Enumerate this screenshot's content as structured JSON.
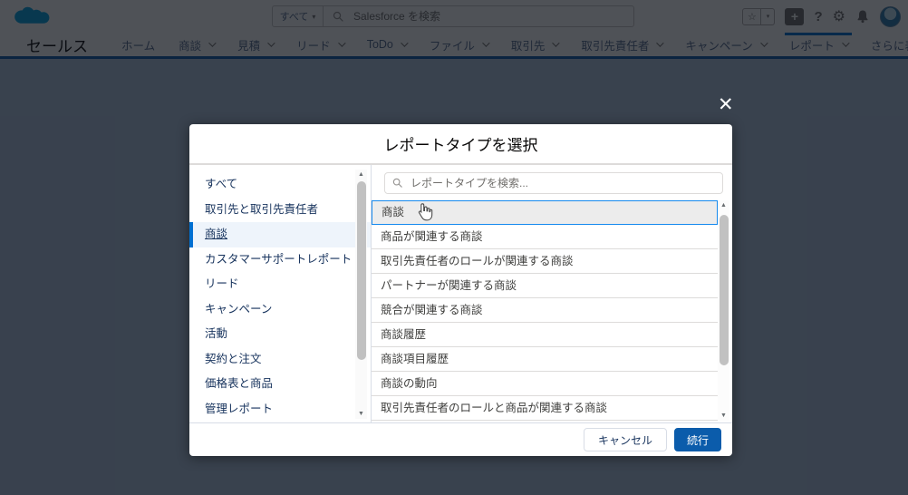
{
  "header": {
    "search_scope_label": "すべて",
    "search_placeholder": "Salesforce を検索"
  },
  "nav": {
    "app_name": "セールス",
    "items": [
      {
        "label": "ホーム"
      },
      {
        "label": "商談"
      },
      {
        "label": "見積"
      },
      {
        "label": "リード"
      },
      {
        "label": "ToDo"
      },
      {
        "label": "ファイル"
      },
      {
        "label": "取引先"
      },
      {
        "label": "取引先責任者"
      },
      {
        "label": "キャンペーン"
      },
      {
        "label": "レポート"
      }
    ],
    "active_item": "レポート",
    "more_label": "さらに表示"
  },
  "modal": {
    "title": "レポートタイプを選択",
    "search_placeholder": "レポートタイプを検索...",
    "categories": [
      "すべて",
      "取引先と取引先責任者",
      "商談",
      "カスタマーサポートレポート",
      "リード",
      "キャンペーン",
      "活動",
      "契約と注文",
      "価格表と商品",
      "管理レポート"
    ],
    "selected_category": "商談",
    "selected_category_index": 2,
    "report_types": [
      "商談",
      "商品が関連する商談",
      "取引先責任者のロールが関連する商談",
      "パートナーが関連する商談",
      "競合が関連する商談",
      "商談履歴",
      "商談項目履歴",
      "商談の動向",
      "取引先責任者のロールと商品が関連する商談"
    ],
    "selected_report_type": "商談",
    "selected_report_index": 0,
    "cancel_label": "キャンセル",
    "continue_label": "続行"
  },
  "icons": {
    "close": "✕",
    "caret_down_small": "▾",
    "triangle_down": "▼",
    "scroll_up": "▲",
    "scroll_down": "▼",
    "star": "☆",
    "plus": "+",
    "help": "?",
    "gear": "⚙",
    "pencil": "✎"
  },
  "colors": {
    "brand_blue": "#0070d2",
    "nav_underline": "#0b5cab",
    "continue_button": "#0b5cab",
    "selected_category_bg": "#eef4fb",
    "selected_row_bg": "#ececec",
    "selected_row_border": "#1589ee",
    "salesforce_cloud": "#00a1e0",
    "page_background": "#b0c4df"
  }
}
